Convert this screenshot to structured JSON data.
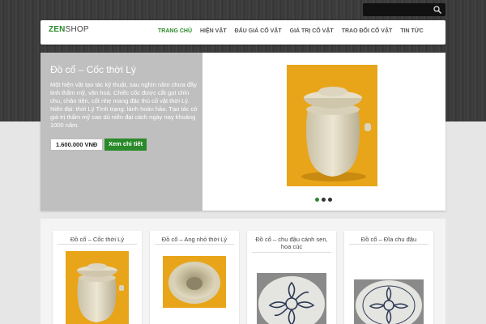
{
  "colors": {
    "accent": "#2a8a2a",
    "slide_panel": "#bfbfbf",
    "header_bg": "#3a3a3a"
  },
  "search": {
    "placeholder": "",
    "icon": "search-icon"
  },
  "logo": {
    "brand": "ZEN",
    "rest": "SHOP"
  },
  "nav": [
    {
      "label": "TRANG CHỦ",
      "active": true
    },
    {
      "label": "HIỆN VẬT"
    },
    {
      "label": "ĐẤU GIÁ CỔ VẬT"
    },
    {
      "label": "GIÁ TRỊ CỔ VẬT"
    },
    {
      "label": "TRAO ĐỔI CỔ VẬT"
    },
    {
      "label": "TIN TỨC"
    }
  ],
  "slide": {
    "title": "Đồ cổ – Cốc thời Lý",
    "description": "Một hiện vật tạo tác kỹ thuật, sau nghìn năm chưa đầy tinh thẩm mỹ, văn hoá. Chiếc cốc được cắt gọt chỉn chu, chân tiện, cốt nhẹ mang đặc thù cổ vật thời Lý. Niên đại: thời Lý Tình trạng: lành hoàn hảo. Tạo tác có giá trị thẩm mỹ cao dù niên đại cách ngày nay khoảng 1000 năm.",
    "price": "1.600.000 VNĐ",
    "button": "Xem chi tiết"
  },
  "products": [
    {
      "title": "Đồ cổ – Cốc thời Lý"
    },
    {
      "title": "Đồ cổ – Ang nhỏ thời Lý"
    },
    {
      "title": "Đồ cổ – chu đậu cánh sen, hoa cúc"
    },
    {
      "title": "Đồ cổ – Đĩa chu đậu"
    }
  ]
}
